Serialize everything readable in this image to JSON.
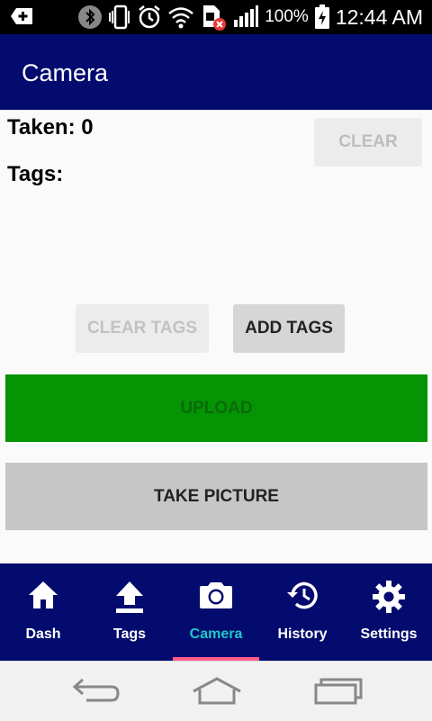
{
  "status_bar": {
    "battery_percent": "100%",
    "time": "12:44 AM"
  },
  "app_bar": {
    "title": "Camera"
  },
  "main": {
    "taken_label": "Taken: 0",
    "tags_label": "Tags:",
    "clear_button": "CLEAR",
    "clear_tags_button": "CLEAR TAGS",
    "add_tags_button": "ADD TAGS",
    "upload_button": "UPLOAD",
    "take_picture_button": "TAKE PICTURE"
  },
  "bottom_nav": {
    "items": [
      {
        "label": "Dash",
        "icon": "home-icon"
      },
      {
        "label": "Tags",
        "icon": "upload-icon"
      },
      {
        "label": "Camera",
        "icon": "camera-icon",
        "active": true
      },
      {
        "label": "History",
        "icon": "history-icon"
      },
      {
        "label": "Settings",
        "icon": "settings-gear-icon"
      }
    ],
    "active_color": "#1ec8c8",
    "indicator_color": "#ff5a8a"
  },
  "colors": {
    "app_bar": "#030b6e",
    "upload": "#049404"
  }
}
